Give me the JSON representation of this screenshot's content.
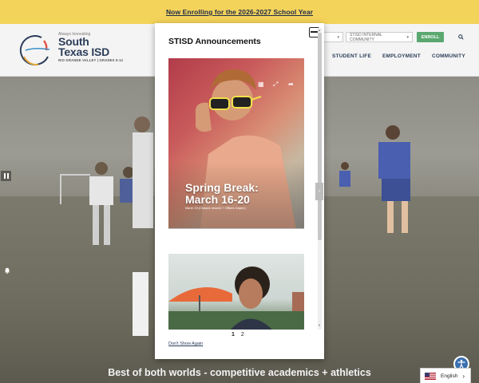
{
  "banner": {
    "text": "Now Enrolling for the 2026-2027 School Year"
  },
  "logo": {
    "tagline": "Always Innovating",
    "name_line1": "South",
    "name_line2": "Texas ISD",
    "subtitle": "RIO GRANDE VALLEY | GRADES 6-12"
  },
  "utility": {
    "internal_label": "STISD INTERNAL COMMUNITY",
    "enroll_label": "ENROLL"
  },
  "nav": {
    "items": [
      "STUDENT LIFE",
      "EMPLOYMENT",
      "COMMUNITY"
    ]
  },
  "hero": {
    "tagline": "Best of both worlds - competitive academics + athletics"
  },
  "modal": {
    "title": "STISD Announcements",
    "card1": {
      "headline_line1": "Spring Break:",
      "headline_line2": "March 16-20",
      "subtext": "March 23 (Classes resume + Offices reopen)"
    },
    "pages": [
      "1",
      "2"
    ],
    "dont_show": "Don't Show Again"
  },
  "language": {
    "label": "English"
  },
  "colors": {
    "banner": "#f3d35a",
    "navy": "#2d3e5a",
    "enroll": "#5aa870",
    "access": "#3a6fb0"
  },
  "icons": [
    "pause-icon",
    "bell-icon",
    "search-icon",
    "close-icon",
    "grid-icon",
    "expand-icon",
    "share-icon",
    "chevron-right-icon",
    "accessibility-icon",
    "us-flag-icon"
  ]
}
